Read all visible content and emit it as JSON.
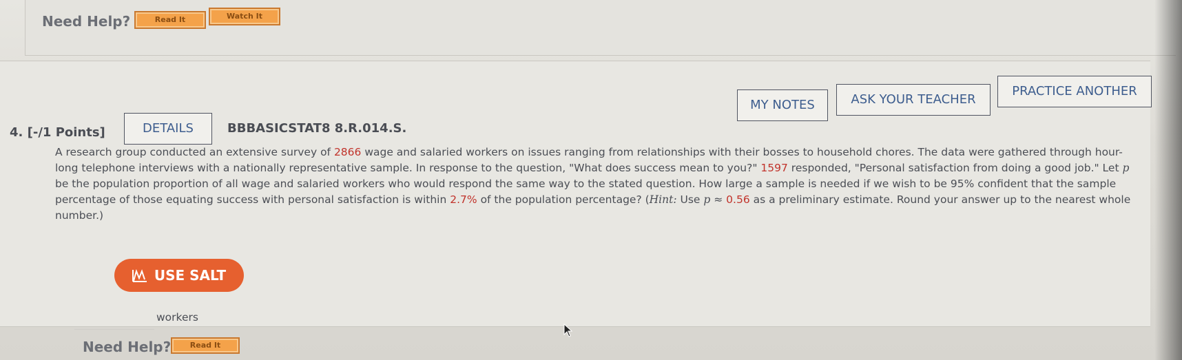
{
  "top_help": {
    "label": "Need Help?",
    "read_it": "Read It",
    "watch_it": "Watch It"
  },
  "question": {
    "number_points": "4.  [-/1 Points]",
    "details_label": "DETAILS",
    "code": "BBBASICSTAT8 8.R.014.S.",
    "my_notes_label": "MY NOTES",
    "ask_teacher_label": "ASK YOUR TEACHER",
    "practice_label": "PRACTICE ANOTHER",
    "text": {
      "p1": "A research group conducted an extensive survey of ",
      "n_workers": "2866",
      "p2": " wage and salaried workers on issues ranging from relationships with their bosses to household chores. The data were gathered through hour-long telephone interviews with a nationally representative sample. In response to the question, \"What does success mean to you?\" ",
      "n_responded": "1597",
      "p3": " responded, \"Personal satisfaction from doing a good job.\" Let ",
      "p_var": "p",
      "p4": " be the population proportion of all wage and salaried workers who would respond the same way to the stated question. How large a sample is needed if we wish to be 95% confident that the sample percentage of those equating success with personal satisfaction is within ",
      "margin": "2.7%",
      "p5": " of the population percentage? (",
      "hint_label": "Hint:",
      "p6": " Use ",
      "p_var2": "p",
      "approx": " ≈ ",
      "p_est": "0.56",
      "p7": " as a preliminary estimate. Round your answer up to the nearest whole number.)"
    },
    "salt_label": "USE SALT",
    "answer_value": "",
    "answer_unit": "workers",
    "help_label": "Need Help?",
    "help_read_it": "Read It"
  },
  "colors": {
    "accent_orange": "#e6602f",
    "help_button": "#f4a24a",
    "number_red": "#c1332b",
    "link_blue": "#3d5d8e"
  }
}
